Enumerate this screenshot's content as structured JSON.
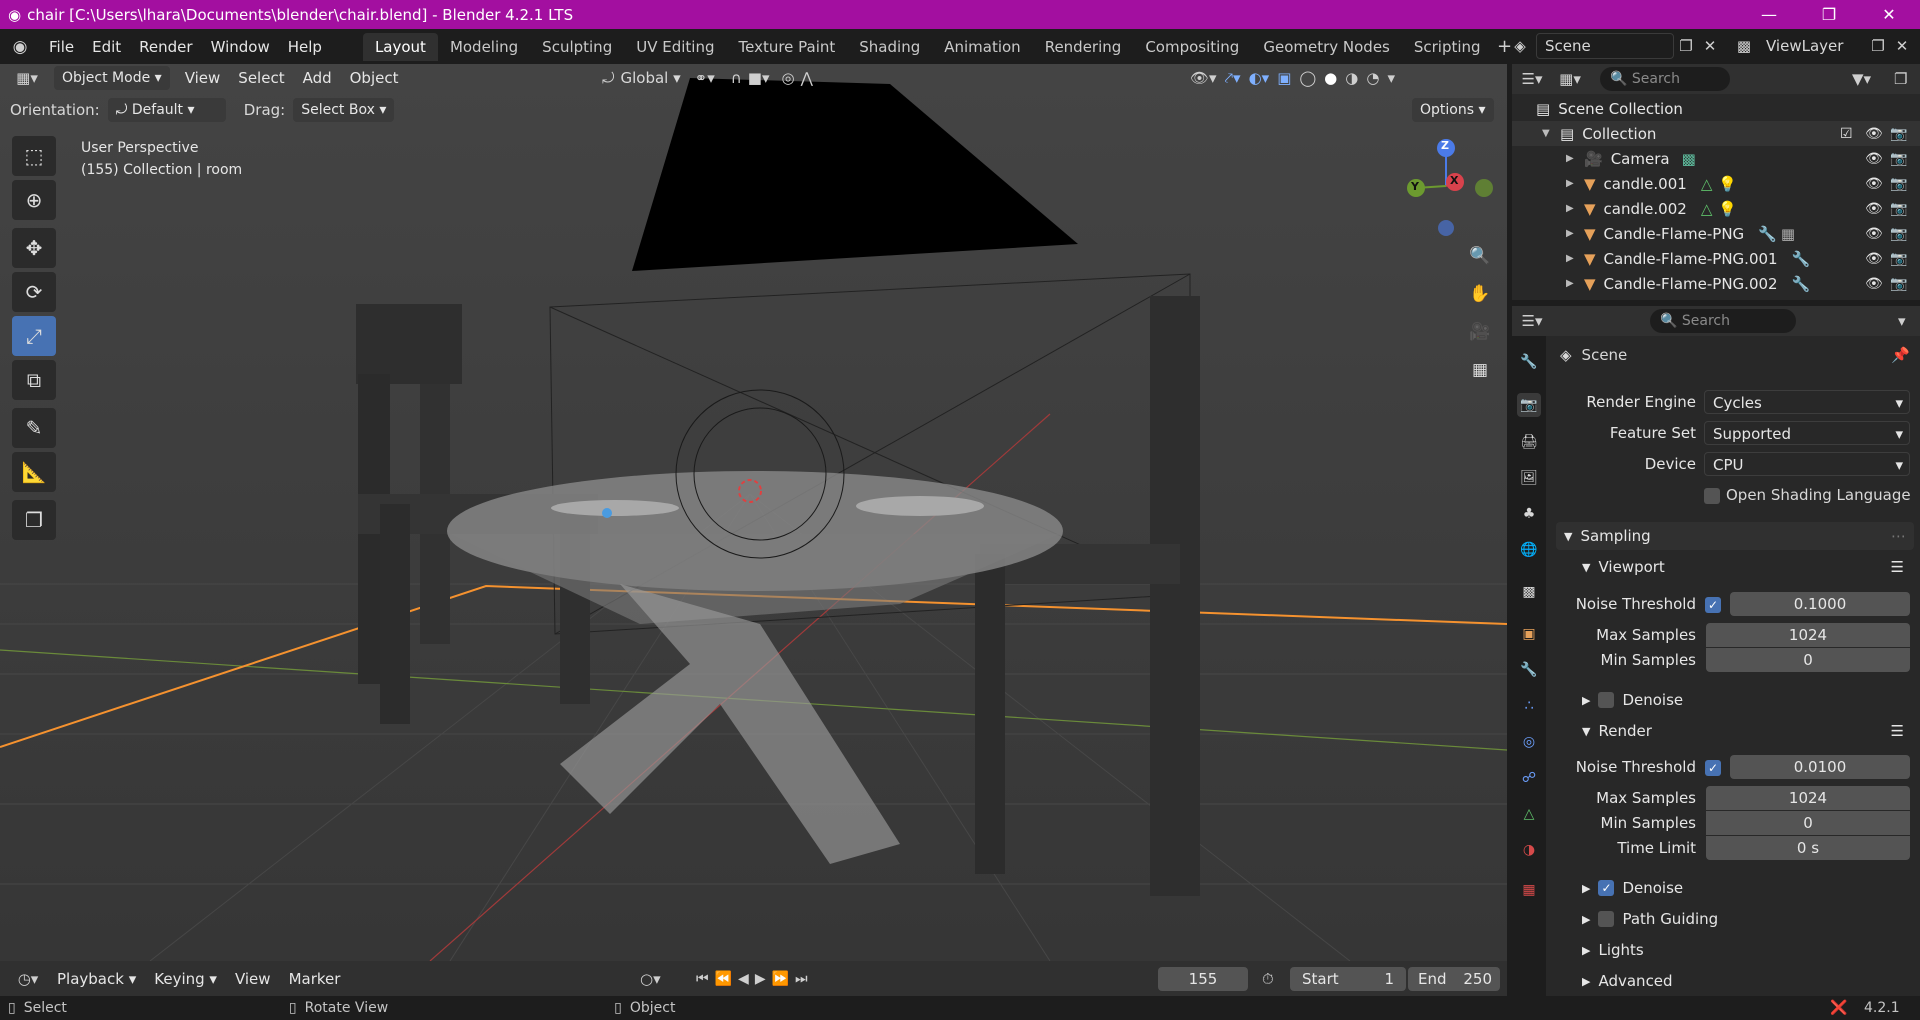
{
  "window": {
    "title": "chair [C:\\Users\\lhara\\Documents\\blender\\chair.blend] - Blender 4.2.1 LTS",
    "minimize": "—",
    "maximize": "❐",
    "close": "✕"
  },
  "menu": [
    "File",
    "Edit",
    "Render",
    "Window",
    "Help"
  ],
  "workspaces": [
    {
      "label": "Layout",
      "active": true
    },
    {
      "label": "Modeling"
    },
    {
      "label": "Sculpting"
    },
    {
      "label": "UV Editing"
    },
    {
      "label": "Texture Paint"
    },
    {
      "label": "Shading"
    },
    {
      "label": "Animation"
    },
    {
      "label": "Rendering"
    },
    {
      "label": "Compositing"
    },
    {
      "label": "Geometry Nodes"
    },
    {
      "label": "Scripting"
    }
  ],
  "scene_selector": {
    "value": "Scene"
  },
  "viewlayer_selector": {
    "value": "ViewLayer"
  },
  "viewport_header": {
    "mode": "Object Mode",
    "menus": [
      "View",
      "Select",
      "Add",
      "Object"
    ],
    "transform": "Global"
  },
  "tool_settings": {
    "orientation_label": "Orientation:",
    "orientation_value": "Default",
    "drag_label": "Drag:",
    "drag_value": "Select Box",
    "options": "Options"
  },
  "viewport_info": {
    "line1": "User Perspective",
    "line2": "(155) Collection | room"
  },
  "gizmo": {
    "z": "Z",
    "y": "Y",
    "x": "X"
  },
  "outliner": {
    "search_placeholder": "Search",
    "root": "Scene Collection",
    "collection": "Collection",
    "items": [
      "Camera",
      "candle.001",
      "candle.002",
      "Candle-Flame-PNG",
      "Candle-Flame-PNG.001",
      "Candle-Flame-PNG.002"
    ]
  },
  "properties": {
    "search_placeholder": "Search",
    "context": "Scene",
    "render_engine_label": "Render Engine",
    "render_engine": "Cycles",
    "feature_set_label": "Feature Set",
    "feature_set": "Supported",
    "device_label": "Device",
    "device": "CPU",
    "osl": "Open Shading Language",
    "sampling": "Sampling",
    "viewport": {
      "title": "Viewport",
      "noise_label": "Noise Threshold",
      "noise": "0.1000",
      "max_label": "Max Samples",
      "max": "1024",
      "min_label": "Min Samples",
      "min": "0",
      "denoise": "Denoise"
    },
    "render": {
      "title": "Render",
      "noise_label": "Noise Threshold",
      "noise": "0.0100",
      "max_label": "Max Samples",
      "max": "1024",
      "min_label": "Min Samples",
      "min": "0",
      "time_label": "Time Limit",
      "time": "0 s",
      "denoise": "Denoise",
      "path_guiding": "Path Guiding"
    },
    "lights": "Lights",
    "advanced": "Advanced"
  },
  "timeline": {
    "menus": [
      "Playback",
      "Keying",
      "View",
      "Marker"
    ],
    "frame": "155",
    "start_label": "Start",
    "start": "1",
    "end_label": "End",
    "end": "250"
  },
  "statusbar": {
    "select": "Select",
    "rotate": "Rotate View",
    "object": "Object",
    "version": "4.2.1"
  },
  "colors": {
    "title_bar": "#a30fa0",
    "accent": "#4772b3",
    "selection_outline": "#f5922f"
  }
}
